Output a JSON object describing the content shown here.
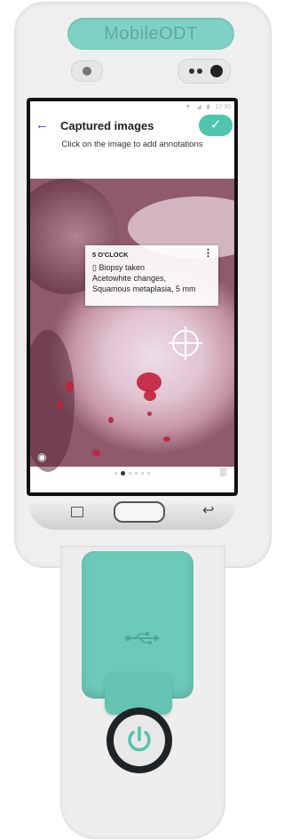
{
  "device": {
    "brand_label": "MobileODT"
  },
  "status_bar": {
    "time": "12:30",
    "icons": [
      "wifi-icon",
      "signal-icon",
      "battery-icon"
    ]
  },
  "app_bar": {
    "back_icon": "arrow-left-icon",
    "title": "Captured images",
    "confirm_icon": "check-icon"
  },
  "instructions": "Click on the image to add annotations",
  "annotation": {
    "position_label": "5 O'CLOCK",
    "lines": [
      "Biopsy taken",
      "Acetowhite changes,",
      "Squamous metaplasia, 5 mm"
    ],
    "menu_icon": "more-vert-icon"
  },
  "image_overlay": {
    "visibility_icon": "eye-icon",
    "crosshair_icon": "crosshair-icon"
  },
  "pager": {
    "count": 6,
    "active_index": 1
  },
  "nav_bar": {
    "icons": [
      "recent-apps-icon",
      "home-icon",
      "back-icon"
    ]
  },
  "colors": {
    "accent": "#4fc5ac",
    "device_teal": "#6ccab8",
    "title_text": "#222222",
    "back_arrow": "#3a3aa0"
  }
}
